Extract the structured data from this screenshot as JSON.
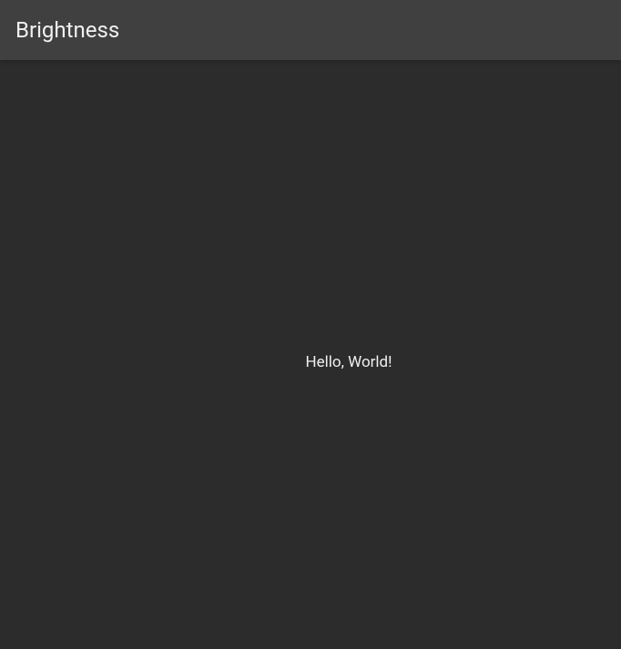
{
  "header": {
    "title": "Brightness"
  },
  "main": {
    "message": "Hello, World!"
  }
}
